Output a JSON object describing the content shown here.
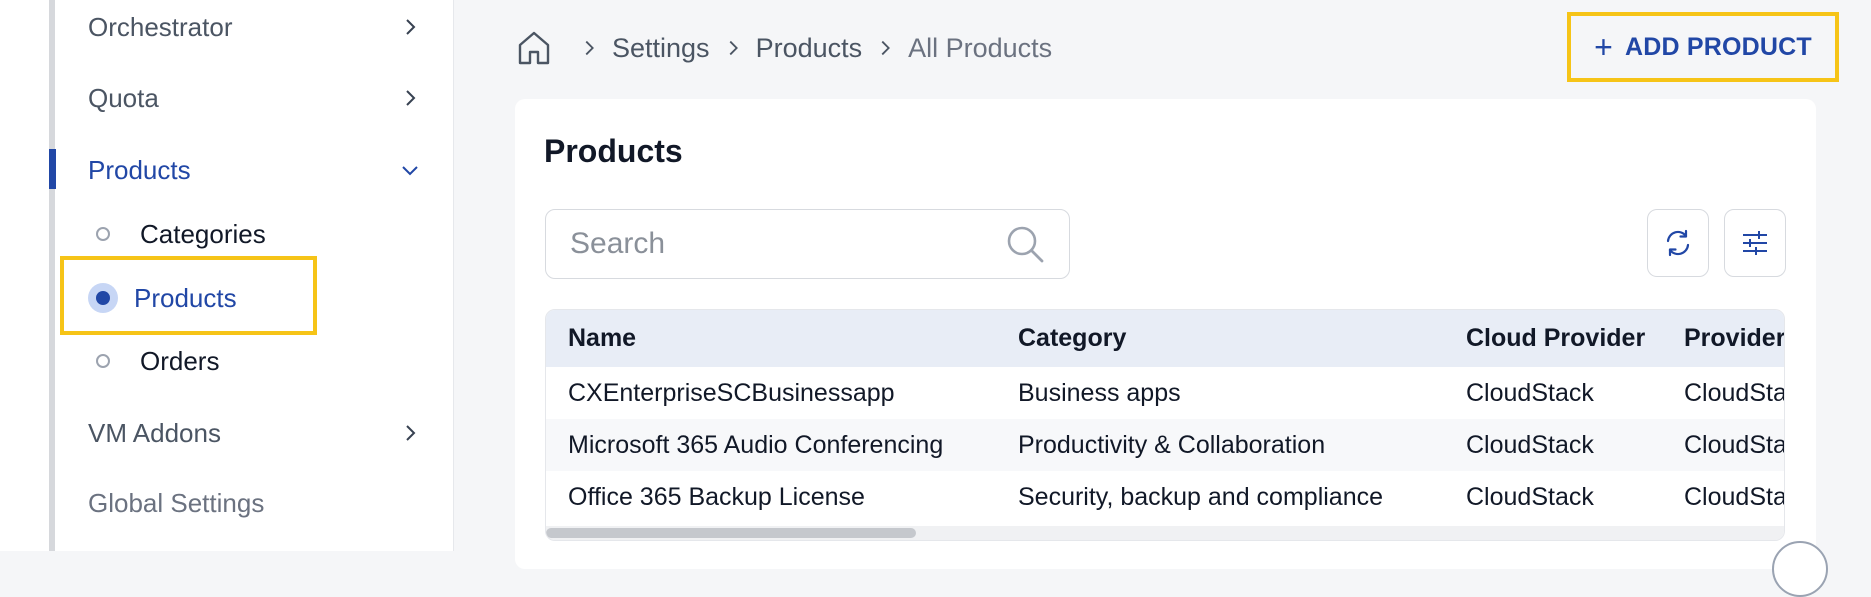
{
  "sidebar": {
    "items": [
      {
        "label": "Orchestrator",
        "expanded": false
      },
      {
        "label": "Quota",
        "expanded": false
      },
      {
        "label": "Products",
        "expanded": true
      },
      {
        "label": "VM Addons",
        "expanded": false
      },
      {
        "label": "Global Settings"
      }
    ],
    "sub_items": [
      {
        "label": "Categories"
      },
      {
        "label": "Products",
        "selected": true
      },
      {
        "label": "Orders"
      }
    ]
  },
  "breadcrumb": {
    "items": [
      "Settings",
      "Products",
      "All Products"
    ]
  },
  "header": {
    "add_button_label": "ADD PRODUCT"
  },
  "main": {
    "title": "Products",
    "search": {
      "placeholder": "Search",
      "value": ""
    },
    "table": {
      "columns": [
        "Name",
        "Category",
        "Cloud Provider",
        "Provider"
      ],
      "rows": [
        [
          "CXEnterpriseSCBusinessapp",
          "Business apps",
          "CloudStack",
          "CloudStack"
        ],
        [
          "Microsoft 365 Audio Conferencing",
          "Productivity & Collaboration",
          "CloudStack",
          "CloudStack"
        ],
        [
          "Office 365 Backup License",
          "Security, backup and compliance",
          "CloudStack",
          "CloudStack"
        ]
      ]
    }
  },
  "colors": {
    "accent": "#2147a6",
    "highlight": "#f6c417",
    "table_header_bg": "#e8edf6"
  }
}
